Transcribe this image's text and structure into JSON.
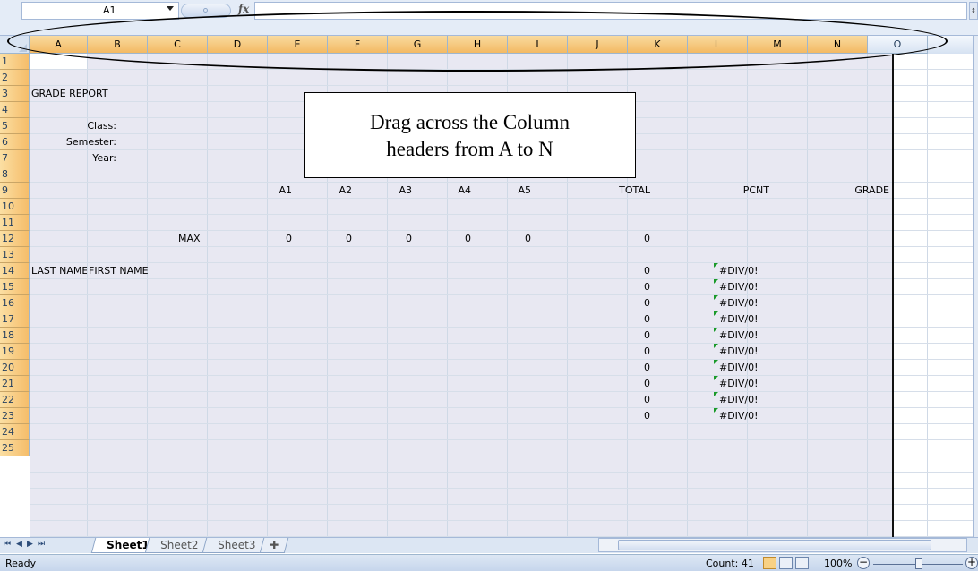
{
  "formula_bar": {
    "name_box": "A1",
    "fx_label": "fx",
    "expand_glyph": "⇕"
  },
  "columns": [
    "A",
    "B",
    "C",
    "D",
    "E",
    "F",
    "G",
    "H",
    "I",
    "J",
    "K",
    "L",
    "M",
    "N",
    "O"
  ],
  "rows": [
    "1",
    "2",
    "3",
    "4",
    "5",
    "6",
    "7",
    "8",
    "9",
    "10",
    "11",
    "12",
    "13",
    "14",
    "15",
    "16",
    "17",
    "18",
    "19",
    "20",
    "21",
    "22",
    "23",
    "24",
    "25"
  ],
  "sheet": {
    "title": "GRADE REPORT",
    "class_label": "Class:",
    "semester_label": "Semester:",
    "year_label": "Year:",
    "headers": [
      "A1",
      "A2",
      "A3",
      "A4",
      "A5"
    ],
    "total_label": "TOTAL",
    "pcnt_label": "PCNT",
    "grade_label": "GRADE",
    "max_label": "MAX",
    "max_values": [
      "0",
      "0",
      "0",
      "0",
      "0"
    ],
    "max_total": "0",
    "last_name_label": "LAST NAME",
    "first_name_label": "FIRST NAME",
    "student_totals": [
      "0",
      "0",
      "0",
      "0",
      "0",
      "0",
      "0",
      "0",
      "0",
      "0"
    ],
    "student_pcnt": [
      "#DIV/0!",
      "#DIV/0!",
      "#DIV/0!",
      "#DIV/0!",
      "#DIV/0!",
      "#DIV/0!",
      "#DIV/0!",
      "#DIV/0!",
      "#DIV/0!",
      "#DIV/0!"
    ]
  },
  "callout": {
    "line1": "Drag across the Column",
    "line2": "headers from A to N"
  },
  "tabs": {
    "sheets": [
      "Sheet1",
      "Sheet2",
      "Sheet3"
    ],
    "active": "Sheet1",
    "nav": [
      "⏮",
      "◀",
      "▶",
      "⏭"
    ]
  },
  "status": {
    "ready": "Ready",
    "count": "Count: 41",
    "zoom": "100%",
    "zoom_minus": "−",
    "zoom_plus": "+"
  },
  "colors": {
    "selection_header": "#f5bd6a",
    "selection_fill": "#e8e8f2",
    "error_marker": "#1a9a2a",
    "ribbon_blue": "#dce6f3"
  }
}
